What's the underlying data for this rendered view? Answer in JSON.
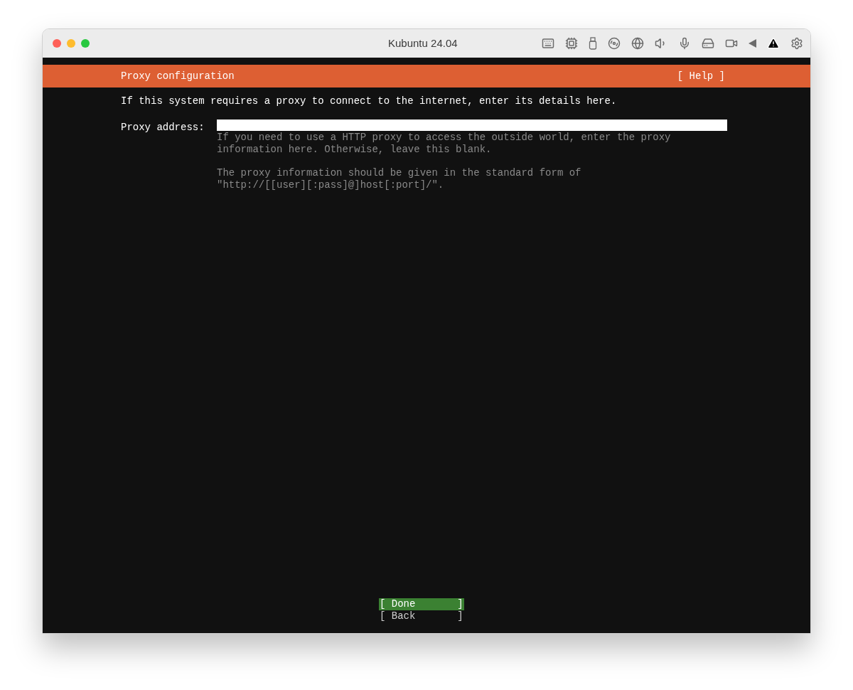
{
  "window": {
    "title": "Kubuntu 24.04"
  },
  "header": {
    "title": "Proxy configuration",
    "help": "[ Help ]"
  },
  "intro": "If this system requires a proxy to connect to the internet, enter its details here.",
  "proxy_field": {
    "label": "Proxy address:",
    "help": [
      "If you need to use a HTTP proxy to access the outside world, enter the proxy\ninformation here. Otherwise, leave this blank.",
      "The proxy information should be given in the standard form of\n\"http://[[user][:pass]@]host[:port]/\"."
    ]
  },
  "buttons": [
    {
      "label": "[ Done       ]",
      "selected": true
    },
    {
      "label": "[ Back       ]",
      "selected": false
    }
  ]
}
